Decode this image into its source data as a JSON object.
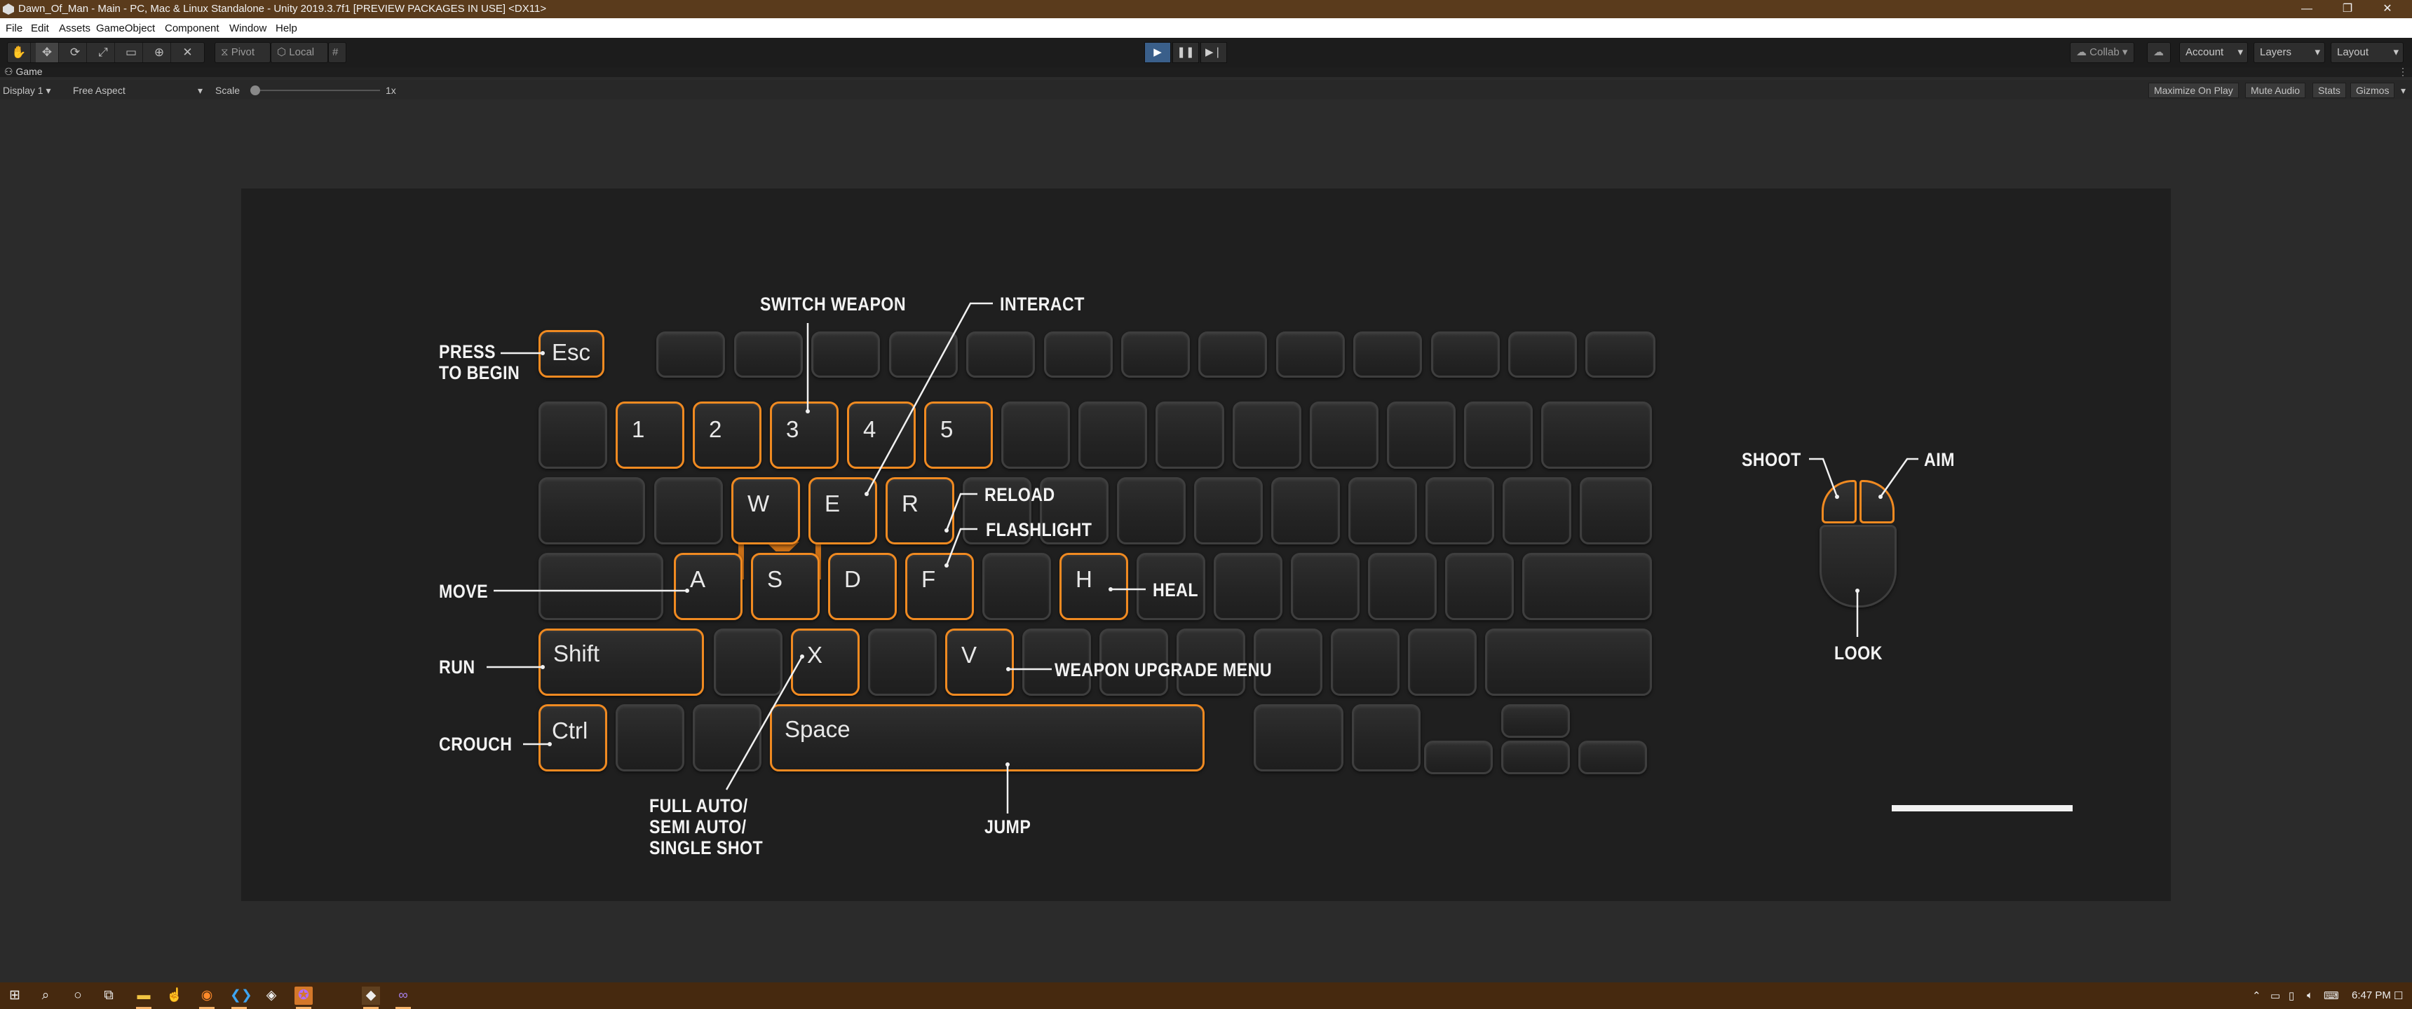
{
  "window": {
    "title": "Dawn_Of_Man - Main - PC, Mac & Linux Standalone - Unity 2019.3.7f1 [PREVIEW PACKAGES IN USE] <DX11>",
    "controls": [
      "—",
      "❐",
      "✕"
    ]
  },
  "menu": [
    "File",
    "Edit",
    "Assets",
    "GameObject",
    "Component",
    "Window",
    "Help"
  ],
  "toolbar": {
    "pivot_label": "Pivot",
    "local_label": "Local",
    "collab_label": "Collab ▾",
    "account_label": "Account",
    "layers_label": "Layers",
    "layout_label": "Layout",
    "play_icon": "▶",
    "pause_icon": "❚❚",
    "step_icon": "▶❘"
  },
  "game_tab": {
    "tab_label": "Game",
    "display_label": "Display 1",
    "aspect_label": "Free Aspect",
    "scale_label": "Scale",
    "scale_value": "1x",
    "scale_fraction": 0,
    "maximize_label": "Maximize On Play",
    "mute_label": "Mute Audio",
    "stats_label": "Stats",
    "gizmos_label": "Gizmos"
  },
  "controls_screen": {
    "keys": {
      "esc": "Esc",
      "k1": "1",
      "k2": "2",
      "k3": "3",
      "k4": "4",
      "k5": "5",
      "w": "W",
      "e": "E",
      "r": "R",
      "a": "A",
      "s": "S",
      "d": "D",
      "f": "F",
      "h": "H",
      "shift": "Shift",
      "x": "X",
      "v": "V",
      "ctrl": "Ctrl",
      "space": "Space"
    },
    "labels": {
      "press_to_begin_1": "PRESS",
      "press_to_begin_2": "TO BEGIN",
      "switch_weapon": "SWITCH  WEAPON",
      "interact": "INTERACT",
      "reload": "RELOAD",
      "flashlight": "FLASHLIGHT",
      "move": "MOVE",
      "heal": "HEAL",
      "run": "RUN",
      "weapon_upgrade_menu": "WEAPON  UPGRADE  MENU",
      "crouch": "CROUCH",
      "fire_mode_1": "FULL AUTO/",
      "fire_mode_2": "SEMI  AUTO/",
      "fire_mode_3": "SINGLE SHOT",
      "jump": "JUMP",
      "shoot": "SHOOT",
      "aim": "AIM",
      "look": "LOOK"
    },
    "highlight_color": "#f08a21"
  },
  "taskbar": {
    "time": "6:47 PM",
    "icons": [
      "windows-start",
      "search",
      "cortana",
      "task-view",
      "file-explorer",
      "hand-cursor",
      "firefox",
      "vscode",
      "unity-hub",
      "messenger",
      "unity",
      "visual-studio"
    ]
  }
}
